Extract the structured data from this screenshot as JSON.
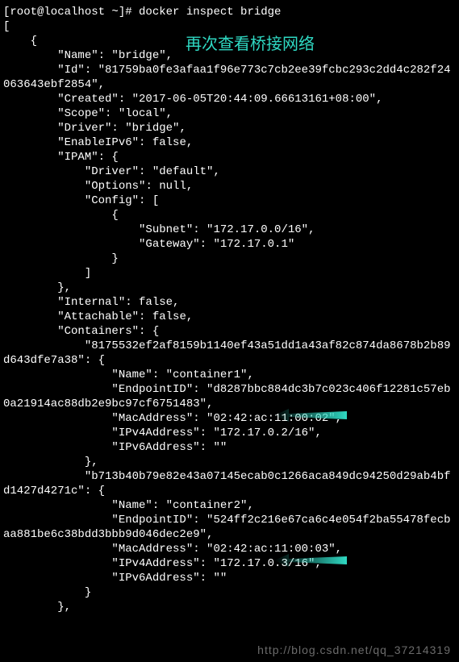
{
  "prompt": "[root@localhost ~]# docker inspect bridge",
  "annotation": "再次查看桥接网络",
  "arrow1_label": "container1 pointer",
  "arrow2_label": "container2 pointer",
  "watermark": "http://blog.csdn.net/qq_37214319",
  "json_lines": {
    "l0": "[",
    "l1": "    {",
    "l2": "        \"Name\": \"bridge\",",
    "l3": "        \"Id\": \"81759ba0fe3afaa1f96e773c7cb2ee39fcbc293c2dd4c282f24063643ebf2854\",",
    "l4": "        \"Created\": \"2017-06-05T20:44:09.66613161+08:00\",",
    "l5": "        \"Scope\": \"local\",",
    "l6": "        \"Driver\": \"bridge\",",
    "l7": "        \"EnableIPv6\": false,",
    "l8": "        \"IPAM\": {",
    "l9": "            \"Driver\": \"default\",",
    "l10": "            \"Options\": null,",
    "l11": "            \"Config\": [",
    "l12": "                {",
    "l13": "                    \"Subnet\": \"172.17.0.0/16\",",
    "l14": "                    \"Gateway\": \"172.17.0.1\"",
    "l15": "                }",
    "l16": "            ]",
    "l17": "        },",
    "l18": "        \"Internal\": false,",
    "l19": "        \"Attachable\": false,",
    "l20": "        \"Containers\": {",
    "l21": "            \"8175532ef2af8159b1140ef43a51dd1a43af82c874da8678b2b89d643dfe7a38\": {",
    "l22": "                \"Name\": \"container1\",",
    "l23": "                \"EndpointID\": \"d8287bbc884dc3b7c023c406f12281c57eb0a21914ac88db2e9bc97cf6751483\",",
    "l24": "                \"MacAddress\": \"02:42:ac:11:00:02\",",
    "l25": "                \"IPv4Address\": \"172.17.0.2/16\",",
    "l26": "                \"IPv6Address\": \"\"",
    "l27": "            },",
    "l28": "            \"b713b40b79e82e43a07145ecab0c1266aca849dc94250d29ab4bfd1427d4271c\": {",
    "l29": "                \"Name\": \"container2\",",
    "l30": "                \"EndpointID\": \"524ff2c216e67ca6c4e054f2ba55478fecbaa881be6c38bdd3bbb9d046dec2e9\",",
    "l31": "                \"MacAddress\": \"02:42:ac:11:00:03\",",
    "l32": "                \"IPv4Address\": \"172.17.0.3/16\",",
    "l33": "                \"IPv6Address\": \"\"",
    "l34": "            }",
    "l35": "        },"
  }
}
